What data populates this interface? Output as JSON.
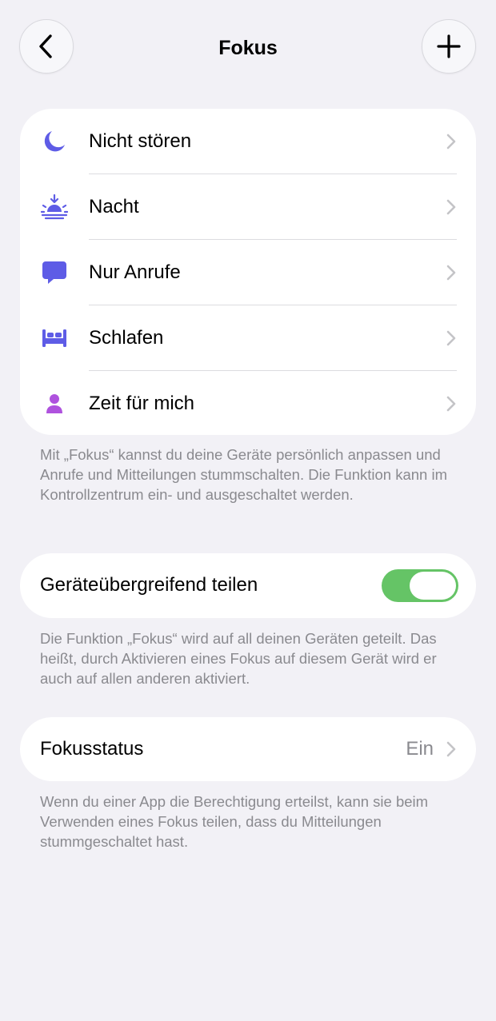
{
  "header": {
    "title": "Fokus"
  },
  "focus_modes": [
    {
      "label": "Nicht stören",
      "icon": "moon-icon"
    },
    {
      "label": "Nacht",
      "icon": "sunset-icon"
    },
    {
      "label": "Nur Anrufe",
      "icon": "speech-bubble-icon"
    },
    {
      "label": "Schlafen",
      "icon": "bed-icon"
    },
    {
      "label": "Zeit für mich",
      "icon": "person-icon"
    }
  ],
  "focus_footnote": "Mit „Fokus“ kannst du deine Geräte persönlich anpassen und Anrufe und Mitteilungen stummschalten. Die Funktion kann im Kontrollzentrum ein- und ausgeschaltet werden.",
  "share": {
    "label": "Geräteübergreifend teilen",
    "enabled": true,
    "footnote": "Die Funktion „Fokus“ wird auf all deinen Geräten geteilt. Das heißt, durch Aktivieren eines Fokus auf diesem Gerät wird er auch auf allen anderen aktiviert."
  },
  "status": {
    "label": "Fokusstatus",
    "value": "Ein",
    "footnote": "Wenn du einer App die Berechtigung erteilst, kann sie beim Verwenden eines Fokus teilen, dass du Mitteilungen stummgeschaltet hast."
  },
  "colors": {
    "background": "#f2f1f6",
    "card": "#ffffff",
    "indigo": "#5e5ce6",
    "purple": "#af52de",
    "toggle_on": "#65c466",
    "secondary_text": "#8a8a8f",
    "chevron": "#c4c4c7"
  }
}
